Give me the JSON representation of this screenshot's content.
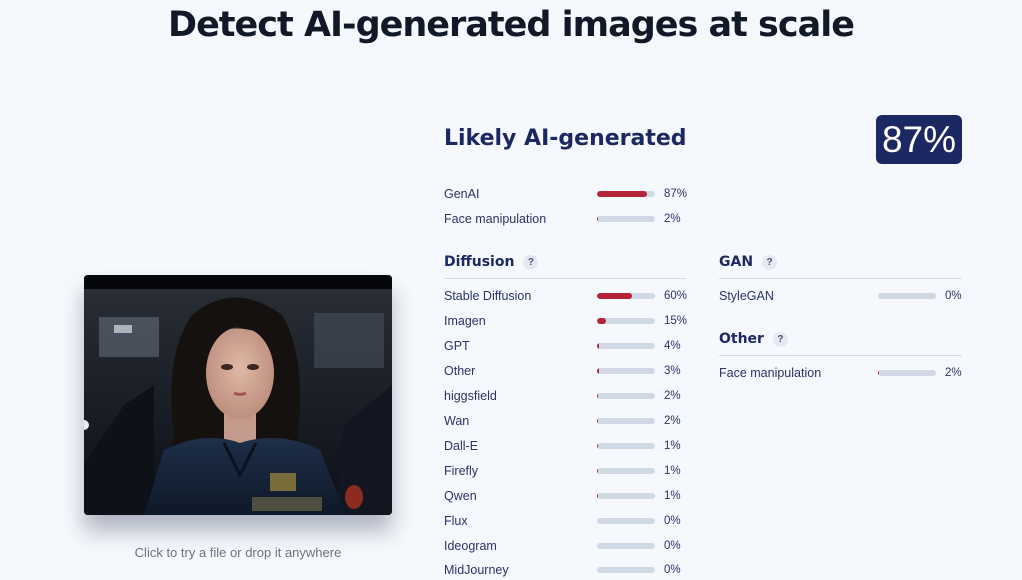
{
  "hero": {
    "title": "Detect AI-generated images at scale"
  },
  "upload": {
    "hint": "Click to try a file or drop it anywhere"
  },
  "result": {
    "verdict": "Likely AI-generated",
    "score_label": "87%",
    "accent_color": "#b42437",
    "badge_color": "#1c2862",
    "summary": [
      {
        "label": "GenAI",
        "value": 87,
        "pct": "87%"
      },
      {
        "label": "Face manipulation",
        "value": 2,
        "pct": "2%"
      }
    ]
  },
  "diffusion": {
    "title": "Diffusion",
    "help": "?",
    "items": [
      {
        "label": "Stable Diffusion",
        "value": 60,
        "pct": "60%"
      },
      {
        "label": "Imagen",
        "value": 15,
        "pct": "15%"
      },
      {
        "label": "GPT",
        "value": 4,
        "pct": "4%"
      },
      {
        "label": "Other",
        "value": 3,
        "pct": "3%"
      },
      {
        "label": "higgsfield",
        "value": 2,
        "pct": "2%"
      },
      {
        "label": "Wan",
        "value": 2,
        "pct": "2%"
      },
      {
        "label": "Dall-E",
        "value": 1,
        "pct": "1%"
      },
      {
        "label": "Firefly",
        "value": 1,
        "pct": "1%"
      },
      {
        "label": "Qwen",
        "value": 1,
        "pct": "1%"
      },
      {
        "label": "Flux",
        "value": 0,
        "pct": "0%"
      },
      {
        "label": "Ideogram",
        "value": 0,
        "pct": "0%"
      },
      {
        "label": "MidJourney",
        "value": 0,
        "pct": "0%"
      }
    ]
  },
  "gan": {
    "title": "GAN",
    "help": "?",
    "items": [
      {
        "label": "StyleGAN",
        "value": 0,
        "pct": "0%"
      }
    ]
  },
  "other": {
    "title": "Other",
    "help": "?",
    "items": [
      {
        "label": "Face manipulation",
        "value": 2,
        "pct": "2%"
      }
    ]
  }
}
